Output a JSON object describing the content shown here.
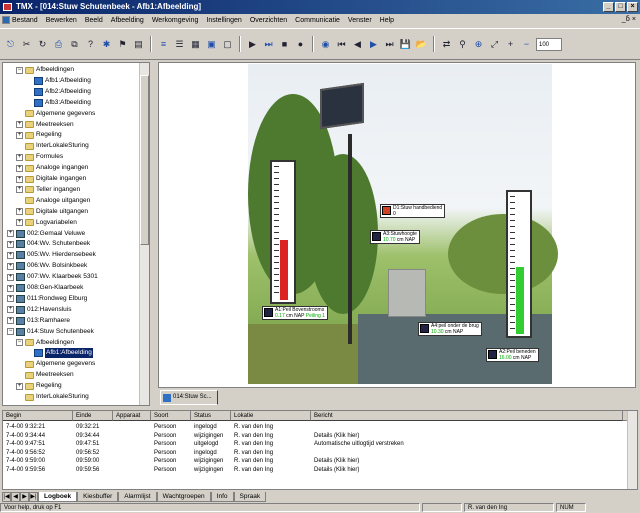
{
  "window": {
    "title": "TMX - [014:Stuw Schutenbeek - Afb1:Afbeelding]"
  },
  "menu": [
    "Bestand",
    "Bewerken",
    "Beeld",
    "Afbeelding",
    "Werkomgeving",
    "Instellingen",
    "Overzichten",
    "Communicatie",
    "Venster",
    "Help"
  ],
  "mdi_controls": "_ẟ ×",
  "toolbar": {
    "icons": [
      "exit-icon",
      "cut-icon",
      "refresh-icon",
      "print-icon",
      "preview-icon",
      "help-icon",
      "tools-icon",
      "flag-icon",
      "page-icon",
      "align-icon",
      "list-icon",
      "grid-icon",
      "table-icon",
      "window-icon",
      "play-icon",
      "step-icon",
      "stop-icon",
      "record-icon",
      "eye-icon",
      "first-icon",
      "prev-icon",
      "next-icon",
      "last-icon",
      "save-icon",
      "open-icon",
      "connect-icon",
      "link-icon",
      "zoom-icon",
      "fit-icon",
      "zoom-in-icon",
      "zoom-out-icon"
    ],
    "glyphs": [
      "⎋",
      "✂",
      "↻",
      "⎙",
      "⧉",
      "?",
      "✱",
      "⚑",
      "▤",
      "≡",
      "☰",
      "▦",
      "▣",
      "▢",
      "▶",
      "⏭",
      "■",
      "●",
      "◉",
      "⏮",
      "◀",
      "▶",
      "⏭",
      "💾",
      "📂",
      "⇄",
      "⚲",
      "⊕",
      "⤢",
      "+",
      "−"
    ],
    "zoom_value": "100"
  },
  "tree": [
    {
      "label": "Afbeeldingen",
      "depth": 2,
      "icon": "folder",
      "exp": "−"
    },
    {
      "label": "Afb1:Afbeelding",
      "depth": 3,
      "icon": "image"
    },
    {
      "label": "Afb2:Afbeelding",
      "depth": 3,
      "icon": "image"
    },
    {
      "label": "Afb3:Afbeelding",
      "depth": 3,
      "icon": "image"
    },
    {
      "label": "Algemene gegevens",
      "depth": 2,
      "icon": "folder"
    },
    {
      "label": "Meetreeksen",
      "depth": 2,
      "icon": "folder",
      "exp": "+"
    },
    {
      "label": "Regeling",
      "depth": 2,
      "icon": "folder",
      "exp": "+"
    },
    {
      "label": "InterLokaleSturing",
      "depth": 2,
      "icon": "folder"
    },
    {
      "label": "Formules",
      "depth": 2,
      "icon": "folder",
      "exp": "+"
    },
    {
      "label": "Analoge ingangen",
      "depth": 2,
      "icon": "folder",
      "exp": "+"
    },
    {
      "label": "Digitale ingangen",
      "depth": 2,
      "icon": "folder",
      "exp": "+"
    },
    {
      "label": "Teller ingangen",
      "depth": 2,
      "icon": "folder",
      "exp": "+"
    },
    {
      "label": "Analoge uitgangen",
      "depth": 2,
      "icon": "folder"
    },
    {
      "label": "Digitale uitgangen",
      "depth": 2,
      "icon": "folder",
      "exp": "+"
    },
    {
      "label": "Logvariabelen",
      "depth": 2,
      "icon": "folder",
      "exp": "+"
    },
    {
      "label": "002:Gemaal Veluwe",
      "depth": 1,
      "icon": "station",
      "exp": "+"
    },
    {
      "label": "004:Wv. Schutenbeek",
      "depth": 1,
      "icon": "station",
      "exp": "+"
    },
    {
      "label": "005:Wv. Hierdensebeek",
      "depth": 1,
      "icon": "station",
      "exp": "+"
    },
    {
      "label": "006:Wv. Bolsinkbeek",
      "depth": 1,
      "icon": "station",
      "exp": "+"
    },
    {
      "label": "007:Wv. Klaarbeek 5301",
      "depth": 1,
      "icon": "station",
      "exp": "+"
    },
    {
      "label": "008:Gen-Klaarbeek",
      "depth": 1,
      "icon": "station",
      "exp": "+"
    },
    {
      "label": "011:Rondweg Elburg",
      "depth": 1,
      "icon": "station",
      "exp": "+"
    },
    {
      "label": "012:Havensluis",
      "depth": 1,
      "icon": "station",
      "exp": "+"
    },
    {
      "label": "013:Ramhaere",
      "depth": 1,
      "icon": "station",
      "exp": "+"
    },
    {
      "label": "014:Stuw Schutenbeek",
      "depth": 1,
      "icon": "station",
      "exp": "−"
    },
    {
      "label": "Afbeeldingen",
      "depth": 2,
      "icon": "folder",
      "exp": "−"
    },
    {
      "label": "Afb1:Afbeelding",
      "depth": 3,
      "icon": "image",
      "selected": true
    },
    {
      "label": "Algemene gegevens",
      "depth": 2,
      "icon": "folder"
    },
    {
      "label": "Meetreeksen",
      "depth": 2,
      "icon": "folder"
    },
    {
      "label": "Regeling",
      "depth": 2,
      "icon": "folder",
      "exp": "+"
    },
    {
      "label": "InterLokaleSturing",
      "depth": 2,
      "icon": "folder"
    }
  ],
  "overlays": {
    "remote": {
      "title": "D1:Stuw handbediend",
      "value": "0"
    },
    "crest": {
      "title": "A3:Stuwhoogte",
      "value": "10.70",
      "unit": "cm NAP"
    },
    "upstream": {
      "title": "A1:Peil Bovenstrooms",
      "value": "0.17",
      "unit": "cm NAP",
      "extra": "Peiling 1"
    },
    "bridge": {
      "title": "A4:peil onder de brug",
      "value": "10.30",
      "unit": "cm NAP"
    },
    "downstream": {
      "title": "A2:Peil beneden",
      "value": "16.00",
      "unit": "cm NAP"
    }
  },
  "gauges": {
    "upstream_level": 0.44,
    "downstream_level": 0.48
  },
  "doc_tab": "014:Stuw Sc...",
  "log": {
    "columns": [
      "Begin",
      "Einde",
      "Apparaat",
      "Soort",
      "Status",
      "Lokatie",
      "Bericht"
    ],
    "rows": [
      [
        "7-4-00 9:32:21",
        "09:32:21",
        "",
        "Persoon",
        "ingelogd",
        "R. van den Ing",
        ""
      ],
      [
        "7-4-00 9:34:44",
        "09:34:44",
        "",
        "Persoon",
        "wijzigingen",
        "R. van den Ing",
        "Details (Klik hier)"
      ],
      [
        "7-4-00 9:47:51",
        "09:47:51",
        "",
        "Persoon",
        "uitgelogd",
        "R. van den Ing",
        "Automatische uitlogtijd verstreken"
      ],
      [
        "7-4-00 9:56:52",
        "09:56:52",
        "",
        "Persoon",
        "ingelogd",
        "R. van den Ing",
        ""
      ],
      [
        "7-4-00 9:59:00",
        "09:59:00",
        "",
        "Persoon",
        "wijzigingen",
        "R. van den Ing",
        "Details (Klik hier)"
      ],
      [
        "7-4-00 9:59:56",
        "09:59:56",
        "",
        "Persoon",
        "wijzigingen",
        "R. van den Ing",
        "Details (Klik hier)"
      ]
    ]
  },
  "tabs": {
    "nav": [
      "|◀",
      "◀",
      "▶",
      "▶|"
    ],
    "items": [
      "Logboek",
      "Kiesbuffer",
      "Alarmlijst",
      "Wachtgroepen",
      "Info",
      "Spraak"
    ],
    "active": 0
  },
  "status": {
    "help": "Voor help, druk op F1",
    "user": "R. van den Ing",
    "mode": "NUM"
  }
}
